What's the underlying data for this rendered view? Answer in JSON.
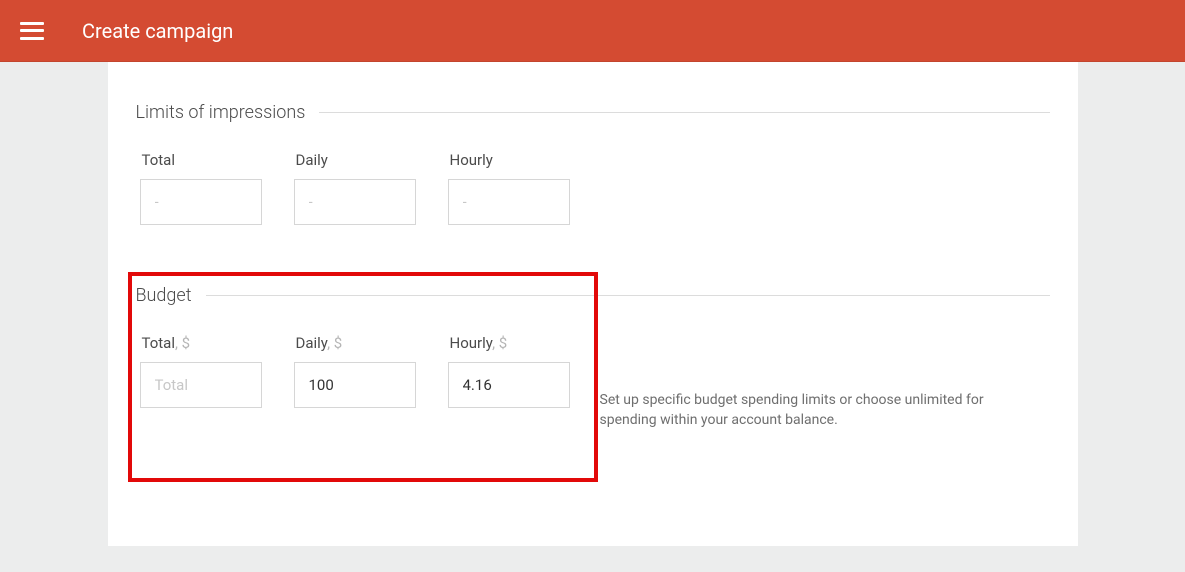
{
  "header": {
    "title": "Create campaign"
  },
  "impressions": {
    "title": "Limits of impressions",
    "total_label": "Total",
    "daily_label": "Daily",
    "hourly_label": "Hourly",
    "total_placeholder": "-",
    "daily_placeholder": "-",
    "hourly_placeholder": "-",
    "total_value": "",
    "daily_value": "",
    "hourly_value": ""
  },
  "budget": {
    "title": "Budget",
    "total_label": "Total",
    "daily_label": "Daily",
    "hourly_label": "Hourly",
    "currency_suffix": ", $",
    "total_placeholder": "Total",
    "daily_placeholder": "",
    "hourly_placeholder": "",
    "total_value": "",
    "daily_value": "100",
    "hourly_value": "4.16",
    "help_text": "Set up specific budget spending limits or choose unlimited for spending within your account balance."
  }
}
